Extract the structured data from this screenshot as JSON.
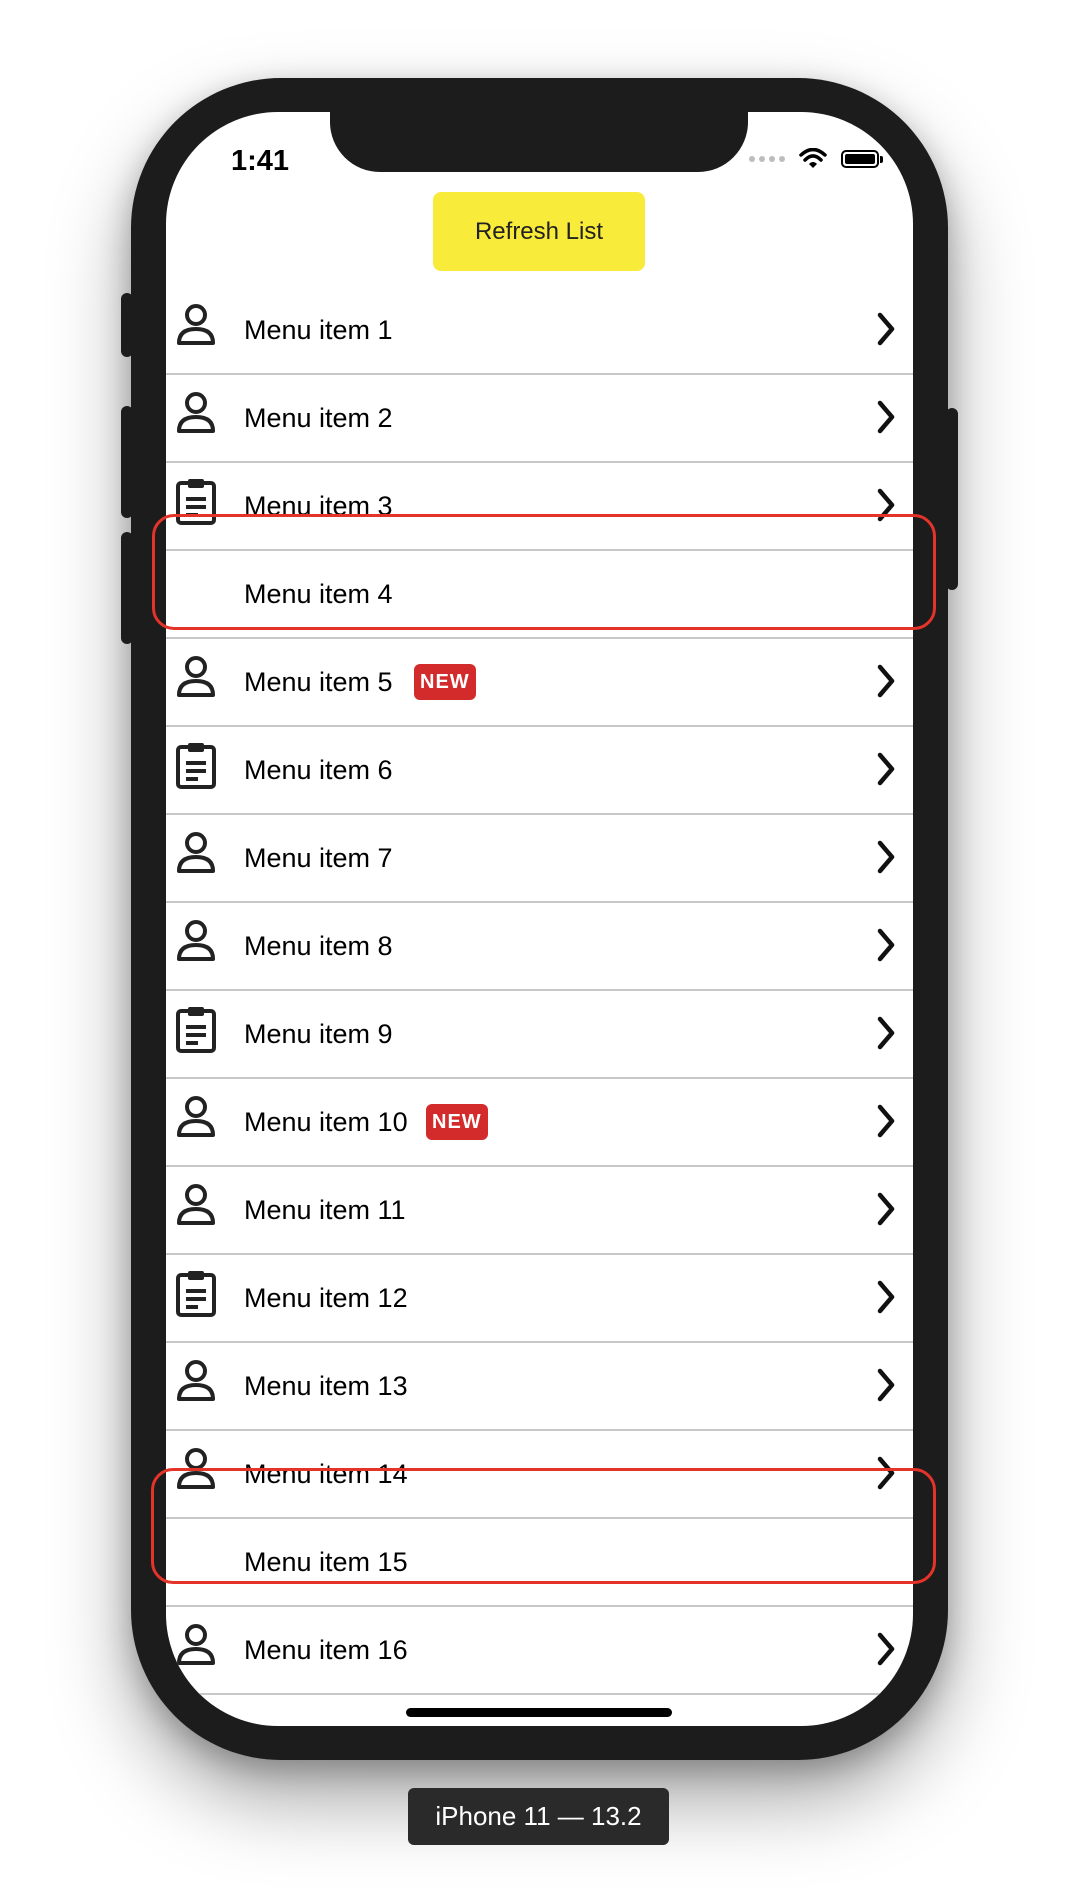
{
  "status_bar": {
    "time": "1:41"
  },
  "refresh_button": {
    "label": "Refresh List"
  },
  "menu_items": [
    {
      "label": "Menu item 1",
      "icon": "person-icon",
      "chevron": true,
      "badge": ""
    },
    {
      "label": "Menu item 2",
      "icon": "person-icon",
      "chevron": true,
      "badge": ""
    },
    {
      "label": "Menu item 3",
      "icon": "clipboard-icon",
      "chevron": true,
      "badge": ""
    },
    {
      "label": "Menu item 4",
      "icon": "",
      "chevron": false,
      "badge": ""
    },
    {
      "label": "Menu item 5",
      "icon": "person-icon",
      "chevron": true,
      "badge": "NEW"
    },
    {
      "label": "Menu item 6",
      "icon": "clipboard-icon",
      "chevron": true,
      "badge": ""
    },
    {
      "label": "Menu item 7",
      "icon": "person-icon",
      "chevron": true,
      "badge": ""
    },
    {
      "label": "Menu item 8",
      "icon": "person-icon",
      "chevron": true,
      "badge": ""
    },
    {
      "label": "Menu item 9",
      "icon": "clipboard-icon",
      "chevron": true,
      "badge": ""
    },
    {
      "label": "Menu item 10",
      "icon": "person-icon",
      "chevron": true,
      "badge": "NEW"
    },
    {
      "label": "Menu item 11",
      "icon": "person-icon",
      "chevron": true,
      "badge": ""
    },
    {
      "label": "Menu item 12",
      "icon": "clipboard-icon",
      "chevron": true,
      "badge": ""
    },
    {
      "label": "Menu item 13",
      "icon": "person-icon",
      "chevron": true,
      "badge": ""
    },
    {
      "label": "Menu item 14",
      "icon": "person-icon",
      "chevron": true,
      "badge": ""
    },
    {
      "label": "Menu item 15",
      "icon": "",
      "chevron": false,
      "badge": ""
    },
    {
      "label": "Menu item 16",
      "icon": "person-icon",
      "chevron": true,
      "badge": ""
    }
  ],
  "device_label": "iPhone 11 — 13.2",
  "colors": {
    "button_yellow": "#f8eb3a",
    "badge_red": "#d32b2b",
    "highlight_red": "#e4342a"
  }
}
